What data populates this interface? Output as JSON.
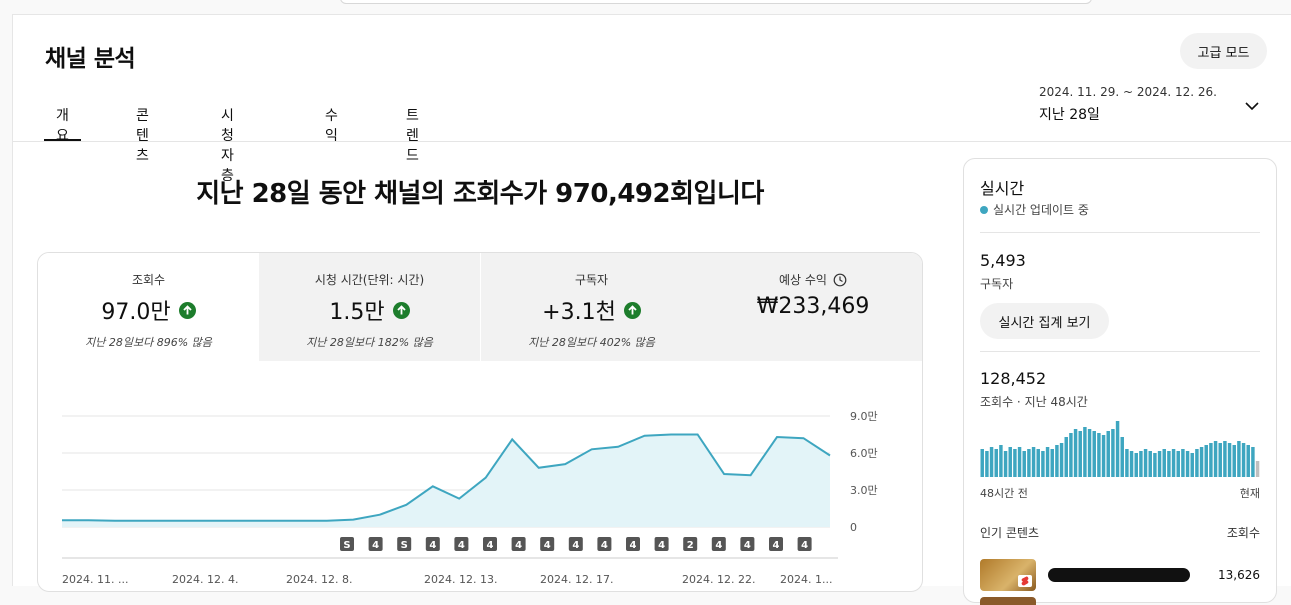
{
  "page": {
    "title": "채널 분석",
    "advanced_mode": "고급 모드",
    "tabs": [
      "개요",
      "콘텐츠",
      "시청자층",
      "수익",
      "트렌드"
    ],
    "date_range": "2024. 11. 29. ~ 2024. 12. 26.",
    "date_label": "지난 28일"
  },
  "headline": "지난 28일 동안 채널의 조회수가 970,492회입니다",
  "metrics": [
    {
      "label": "조회수",
      "value": "97.0만",
      "sub": "지난 28일보다 896% 많음",
      "trend": "up"
    },
    {
      "label": "시청 시간(단위: 시간)",
      "value": "1.5만",
      "sub": "지난 28일보다 182% 많음",
      "trend": "up"
    },
    {
      "label": "구독자",
      "value": "+3.1천",
      "sub": "지난 28일보다 402% 많음",
      "trend": "up"
    },
    {
      "label": "예상 수익",
      "value": "₩233,469",
      "sub": "",
      "trend": "none"
    }
  ],
  "chart_data": {
    "type": "area",
    "series": [
      {
        "values": [
          5500,
          5500,
          5000,
          5000,
          5000,
          5000,
          5000,
          5000,
          5000,
          5000,
          5000,
          6000,
          10000,
          18000,
          33000,
          23000,
          40000,
          71000,
          48000,
          51000,
          63000,
          65000,
          74000,
          75000,
          75000,
          43000,
          42000,
          73000,
          72000,
          58000
        ]
      }
    ],
    "x_tick_labels": [
      "2024. 11. ...",
      "2024. 12. 4.",
      "2024. 12. 8.",
      "2024. 12. 13.",
      "2024. 12. 17.",
      "2024. 12. 22.",
      "2024. 1..."
    ],
    "y_tick_labels": [
      "9.0만",
      "6.0만",
      "3.0만",
      "0"
    ],
    "ylim": [
      0,
      90000
    ],
    "color": "#3ea6c0",
    "markers": [
      "shorts",
      "4",
      "shorts",
      "4",
      "4",
      "4",
      "4",
      "4",
      "4",
      "4",
      "4",
      "4",
      "2",
      "4",
      "4",
      "4",
      "4"
    ]
  },
  "realtime": {
    "title": "실시간",
    "update": "실시간 업데이트 중",
    "subscribers": "5,493",
    "subscribers_label": "구독자",
    "button": "실시간 집계 보기",
    "views": "128,452",
    "views_label": "조회수 · 지난 48시간",
    "bars": [
      14,
      13,
      15,
      14,
      16,
      13,
      15,
      14,
      15,
      13,
      14,
      15,
      14,
      13,
      15,
      14,
      16,
      17,
      20,
      22,
      24,
      23,
      25,
      24,
      23,
      22,
      21,
      23,
      24,
      28,
      20,
      14,
      13,
      12,
      13,
      14,
      13,
      12,
      13,
      14,
      13,
      14,
      13,
      14,
      13,
      12,
      14,
      15,
      16,
      17,
      18,
      17,
      18,
      17,
      16,
      18,
      17,
      16,
      15,
      8
    ],
    "from_label": "48시간 전",
    "to_label": "현재",
    "popular_label": "인기 콘텐츠",
    "popular_views_label": "조회수",
    "top_item_views": "13,626"
  }
}
